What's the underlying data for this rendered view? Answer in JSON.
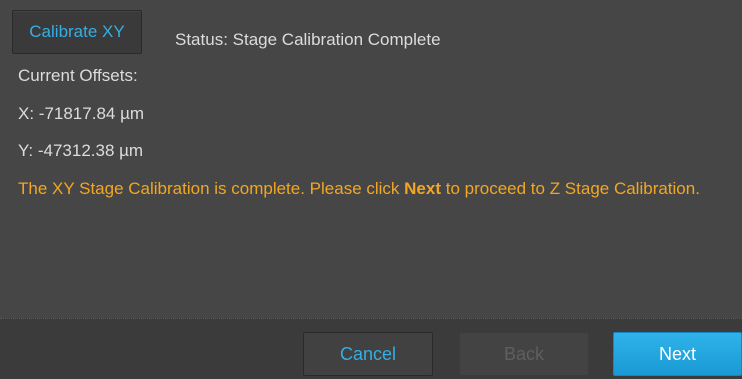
{
  "calibrate_button": {
    "label": "Calibrate XY"
  },
  "status": {
    "text": "Status: Stage Calibration Complete"
  },
  "offsets": {
    "heading": "Current Offsets:",
    "x": "X:  -71817.84 µm",
    "y": "Y:  -47312.38 µm"
  },
  "message": {
    "before": "The XY Stage Calibration is complete. Please click ",
    "emphasis": "Next",
    "after": " to proceed to Z Stage Calibration."
  },
  "footer": {
    "cancel_label": "Cancel",
    "back_label": "Back",
    "next_label": "Next"
  },
  "colors": {
    "accent": "#35aee6",
    "message": "#f2a623",
    "background": "#464646",
    "next_button": "#1a9ad4"
  }
}
